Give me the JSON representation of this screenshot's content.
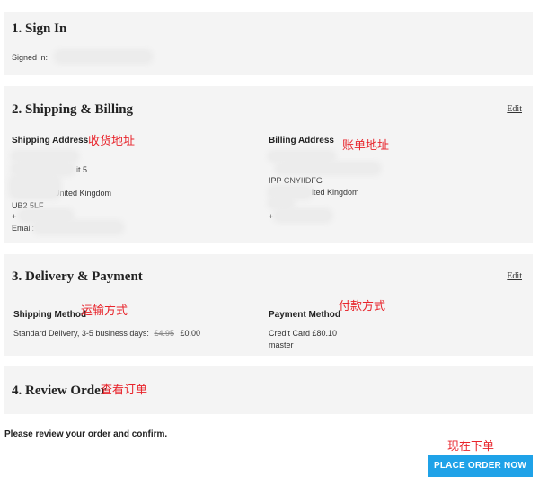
{
  "sign_in": {
    "title": "1. Sign In",
    "signed_in_label": "Signed in: "
  },
  "shipping_billing": {
    "title": "2. Shipping & Billing",
    "edit_label": "Edit",
    "shipping_address": {
      "heading": "Shipping Address",
      "annotation": "收货地址",
      "line_partial": "it 5",
      "country_fragment": "United Kingdom",
      "postcode": "UB2 5LF",
      "phone_prefix": "+",
      "email_label": "Email:"
    },
    "billing_address": {
      "heading": "Billing Address",
      "annotation": "账单地址",
      "line2": "IPP CNYIIDFG",
      "country_fragment": "ited Kingdom",
      "phone_prefix": "+"
    }
  },
  "delivery_payment": {
    "title": "3. Delivery & Payment",
    "edit_label": "Edit",
    "shipping_method": {
      "heading": "Shipping Method",
      "annotation": "运输方式",
      "option": "Standard Delivery, 3-5 business days:",
      "old_price": "£4.95",
      "new_price": "£0.00"
    },
    "payment_method": {
      "heading": "Payment Method",
      "annotation": "付款方式",
      "line1": "Credit Card £80.10",
      "line2": "master"
    }
  },
  "review_order": {
    "title": "4. Review Order",
    "annotation": "查看订单"
  },
  "footer": {
    "instruction": "Please review your order and confirm.",
    "annotation": "现在下单",
    "place_order_label": "PLACE ORDER NOW"
  },
  "colors": {
    "panel_bg": "#f4f4f4",
    "annotation_red": "#e8242b",
    "button_blue": "#1fa2e8"
  }
}
